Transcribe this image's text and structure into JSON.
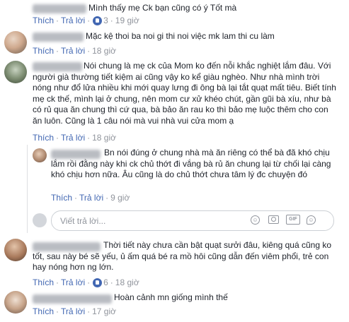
{
  "actions": {
    "like": "Thích",
    "reply": "Trả lời"
  },
  "comments": [
    {
      "text": "Mình thấy mẹ Ck bạn cũng có ý Tốt mà",
      "likes": "3",
      "time": "19 giờ"
    },
    {
      "text": "Mặc kệ thoi ba noi gi thi noi việc mk lam thi cu làm",
      "likes": "",
      "time": "18 giờ"
    },
    {
      "text": "Nói chung là mẹ ck của Mom ko đến nỗi khắc nghiệt lắm đâu. Với người già thường tiết kiệm ai cũng vậy ko kể giàu nghèo. Như nhà mình trời nóng như đổ lửa nhiều khi mới quay lưng đi ông bà lại tắt quạt mất tiêu. Biết tính mẹ ck thế, mình lại ở chung, nên mom cư xử khéo chút, gần gũi bà xíu, như bà có rủ qua ăn chung thì cứ qua, bà bảo ăn rau ko thì bảo mẹ luộc thêm cho con ăn luôn. Cũng là 1 câu nói mà vui nhà vui cửa mom ạ",
      "likes": "",
      "time": "18 giờ"
    },
    {
      "text": "Bn nói đúng ở chung nhà mà ăn riêng có thể bà đã khó chịu lắm rồi đằng này khi ck chủ thớt đi vắng bà rủ ăn chung lại từ chối lại càng khó chịu hơn nữa. Âu cũng là do chủ thớt chưa tâm lý đc chuyện đó",
      "likes": "",
      "time": "9 giờ"
    },
    {
      "text": "Thời tiết này chưa cần bật quạt sưởi đâu, kiêng quá cũng ko tốt, sau này bé sẽ yếu, ủ ấm quá bé ra mồ hôi cũng dẫn đến viêm phổi, trẻ con hay nóng hơn ng lớn.",
      "likes": "6",
      "time": "18 giờ"
    },
    {
      "text": "Hoàn cảnh mn giống mình thế",
      "likes": "",
      "time": "17 giờ"
    }
  ],
  "reply_input": {
    "placeholder": "Viết trả lời..."
  },
  "input_icons": [
    "emoji-icon",
    "camera-icon",
    "gif-icon",
    "sticker-icon"
  ]
}
